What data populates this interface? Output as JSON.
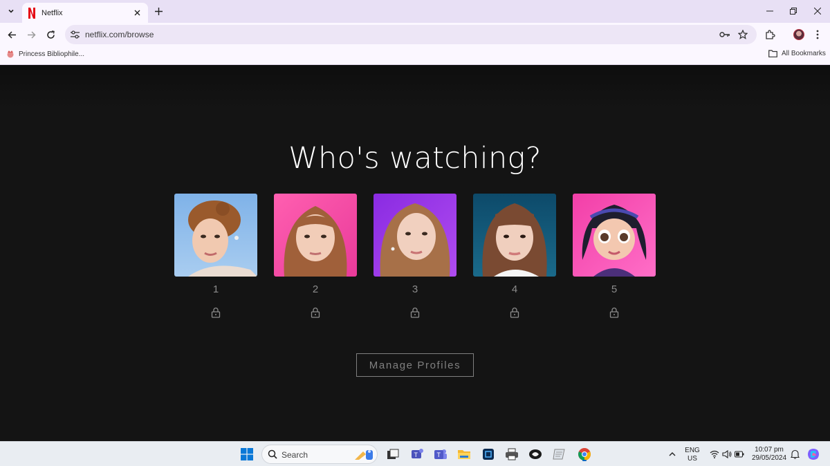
{
  "browser": {
    "tab": {
      "title": "Netflix"
    },
    "address": {
      "url": "netflix.com/browse"
    },
    "bookmarks": {
      "first": "Princess Bibliophile...",
      "all": "All Bookmarks"
    }
  },
  "page": {
    "headline": "Who's watching?",
    "profiles": [
      {
        "name": "1",
        "locked": true
      },
      {
        "name": "2",
        "locked": true
      },
      {
        "name": "3",
        "locked": true
      },
      {
        "name": "4",
        "locked": true
      },
      {
        "name": "5",
        "locked": true
      }
    ],
    "manage_label": "Manage Profiles"
  },
  "taskbar": {
    "search_label": "Search",
    "lang_line1": "ENG",
    "lang_line2": "US",
    "time": "10:07 pm",
    "date": "29/05/2024"
  },
  "colors": {
    "netflix_red": "#e50914",
    "page_bg": "#141414",
    "tabstrip": "#e8e0f5",
    "toolbar": "#fbf7ff"
  }
}
